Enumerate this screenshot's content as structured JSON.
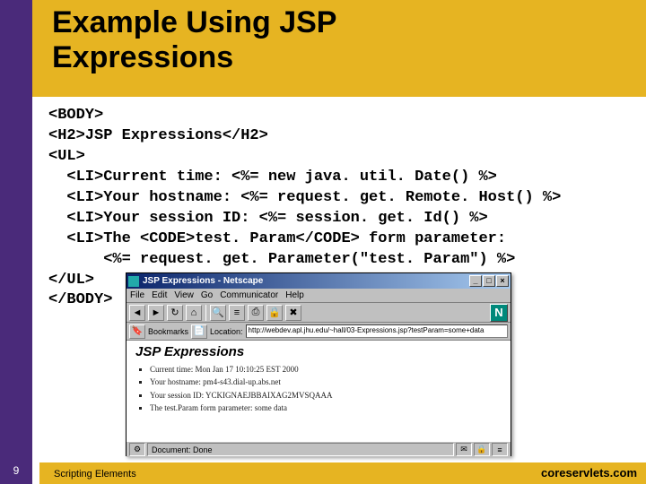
{
  "slide": {
    "title": "Example Using JSP Expressions",
    "number": "9",
    "footer_left": "Scripting Elements",
    "footer_right": "coreservlets.com"
  },
  "code": {
    "lines": [
      "<BODY>",
      "<H2>JSP Expressions</H2>",
      "<UL>",
      "  <LI>Current time: <%= new java. util. Date() %>",
      "  <LI>Your hostname: <%= request. get. Remote. Host() %>",
      "  <LI>Your session ID: <%= session. get. Id() %>",
      "  <LI>The <CODE>test. Param</CODE> form parameter:",
      "      <%= request. get. Parameter(\"test. Param\") %>",
      "</UL>",
      "</BODY>"
    ]
  },
  "browser": {
    "title": "JSP Expressions - Netscape",
    "menus": [
      "File",
      "Edit",
      "View",
      "Go",
      "Communicator",
      "Help"
    ],
    "toolbar_icons": [
      "back",
      "forward",
      "reload",
      "home",
      "search",
      "guide",
      "print",
      "security",
      "stop"
    ],
    "bookmarks_label": "Bookmarks",
    "location_label": "Location:",
    "location_value": "http://webdev.apl.jhu.edu/~hall/03-Expressions.jsp?testParam=some+data",
    "page_heading": "JSP Expressions",
    "page_items": [
      "Current time: Mon Jan 17 10:10:25 EST 2000",
      "Your hostname: pm4-s43.dial-up.abs.net",
      "Your session ID: YCKIGNAEJBBAIXAG2MVSQAAA",
      "The test.Param form parameter: some data"
    ],
    "status_text": "Document: Done",
    "win_buttons": {
      "min": "_",
      "max": "□",
      "close": "×"
    }
  },
  "icons": {
    "back": "◄",
    "forward": "►",
    "reload": "↻",
    "home": "⌂",
    "search": "🔍",
    "guide": "≡",
    "print": "⎙",
    "security": "🔒",
    "stop": "✖",
    "bookmark": "🔖",
    "location": "📄",
    "status1": "⚙",
    "status2": "✉",
    "status3": "🔒",
    "status4": "≡"
  }
}
